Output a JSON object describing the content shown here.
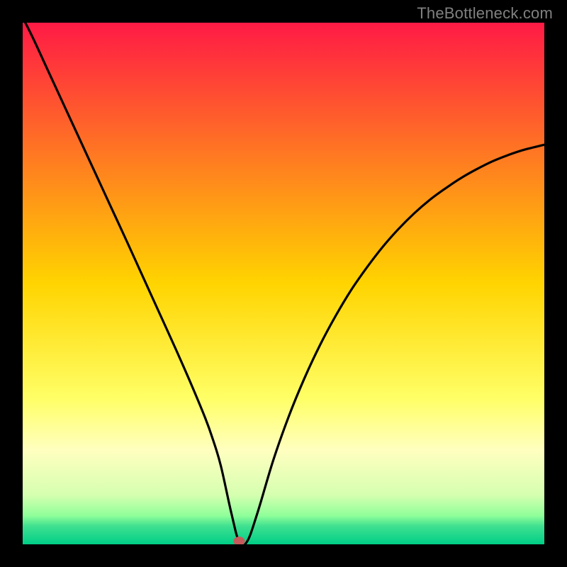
{
  "attribution": "TheBottleneck.com",
  "chart_data": {
    "type": "line",
    "title": "",
    "xlabel": "",
    "ylabel": "",
    "xlim": [
      0,
      100
    ],
    "ylim": [
      0,
      100
    ],
    "gradient_stops": [
      {
        "offset": 0.0,
        "color": "#ff1a45"
      },
      {
        "offset": 0.5,
        "color": "#ffd400"
      },
      {
        "offset": 0.72,
        "color": "#ffff66"
      },
      {
        "offset": 0.82,
        "color": "#ffffc0"
      },
      {
        "offset": 0.905,
        "color": "#d6ffb0"
      },
      {
        "offset": 0.945,
        "color": "#8fff9a"
      },
      {
        "offset": 0.965,
        "color": "#40e090"
      },
      {
        "offset": 1.0,
        "color": "#00cf87"
      }
    ],
    "series": [
      {
        "name": "bottleneck-curve",
        "x": [
          0,
          2,
          5,
          8,
          11,
          14,
          17,
          20,
          23,
          26,
          29,
          32,
          35,
          36.5,
          38,
          40,
          41.5,
          43,
          45,
          48,
          51,
          54,
          57,
          60,
          63,
          66,
          69,
          72,
          75,
          78,
          81,
          84,
          87,
          90,
          93,
          96,
          100
        ],
        "y": [
          101,
          97,
          90.5,
          84,
          77.5,
          71,
          64.5,
          58,
          51.4,
          44.8,
          38.2,
          31.4,
          24.2,
          20.0,
          15.0,
          6.0,
          0.5,
          0.5,
          6.0,
          16.0,
          24.5,
          31.8,
          38.2,
          43.8,
          48.8,
          53.1,
          57.0,
          60.4,
          63.4,
          66.0,
          68.2,
          70.2,
          71.9,
          73.4,
          74.6,
          75.6,
          76.6
        ]
      }
    ],
    "marker": {
      "x": 41.5,
      "y": 0.6,
      "color": "#c65a5a"
    }
  }
}
